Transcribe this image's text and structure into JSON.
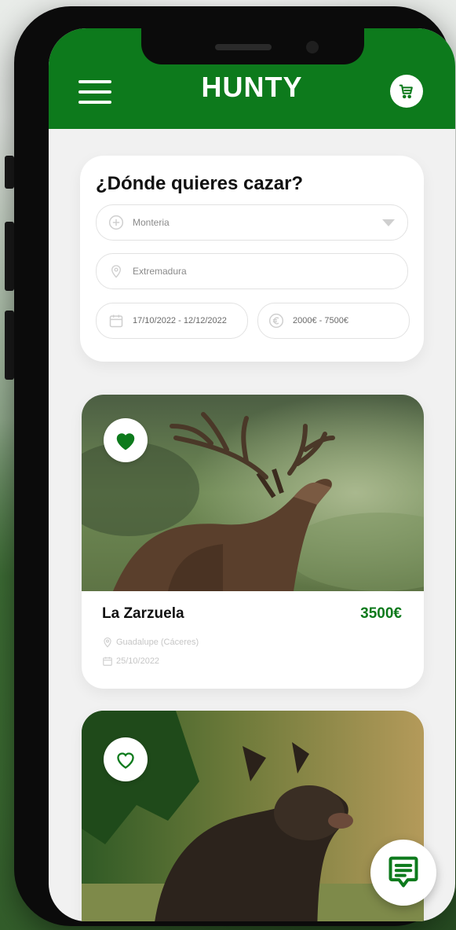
{
  "app": {
    "brand": "HUNTY"
  },
  "colors": {
    "brand_green": "#0d7a1c",
    "background": "#f1f1f1",
    "card": "#ffffff",
    "muted_text": "#8a8a8a"
  },
  "header": {
    "menu_icon": "hamburger-icon",
    "cart_icon": "cart-icon"
  },
  "search": {
    "title": "¿Dónde quieres cazar?",
    "hunt_type": {
      "value": "Monteria",
      "icon": "plus-circle-icon"
    },
    "location": {
      "value": "Extremadura",
      "icon": "location-pin-icon"
    },
    "dates": {
      "value": "17/10/2022 - 12/12/2022",
      "icon": "calendar-icon"
    },
    "price_range": {
      "value": "2000€ - 7500€",
      "icon": "euro-icon"
    }
  },
  "listings": [
    {
      "name": "La Zarzuela",
      "price": "3500€",
      "location": "Guadalupe (Cáceres)",
      "date": "25/10/2022",
      "favorite": true,
      "photo_icon": "deer-photo"
    },
    {
      "favorite": false,
      "photo_icon": "boar-photo"
    }
  ],
  "chat": {
    "icon": "chat-icon"
  }
}
